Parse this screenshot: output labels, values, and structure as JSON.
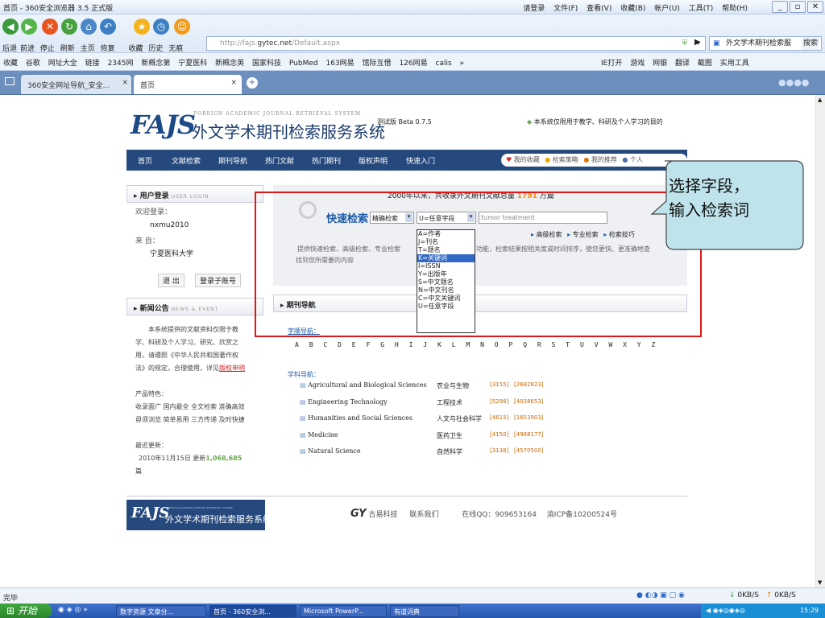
{
  "browser": {
    "window_title": "首页 - 360安全浏览器 3.5 正式版",
    "menu": [
      "请登录",
      "文件(F)",
      "查看(V)",
      "收藏(B)",
      "帐户(U)",
      "工具(T)",
      "帮助(H)"
    ],
    "nav_labels": [
      "后退",
      "前进",
      "停止",
      "刷新",
      "主页",
      "恢复",
      "收藏",
      "历史",
      "无痕"
    ],
    "url_prefix": "http://fajs.",
    "url_domain": "gytec.net",
    "url_path": "/Default.aspx",
    "search_box": "外文学术期刊检索服",
    "search_btn": "搜索",
    "favorites": [
      "收藏",
      "谷歌",
      "网址大全",
      "链接",
      "2345网",
      "新概念第",
      "宁夏医科",
      "新概念英",
      "国家科技",
      "PubMed",
      "163网易",
      "馆际互借",
      "126网易",
      "calis",
      "»"
    ],
    "favorites_right": [
      "IE打开",
      "游戏",
      "网银",
      "翻译",
      "截图",
      "实用工具"
    ],
    "tabs": [
      {
        "label": "360安全网址导航_安全..."
      },
      {
        "label": "首页"
      }
    ],
    "status_text": "完毕",
    "speed_down": "0KB/S",
    "speed_up": "0KB/S"
  },
  "page": {
    "logo_big": "FAJS",
    "logo_sub": "FOREIGN ACADEMIC JOURNAL RETRIEVAL SYSTEM",
    "logo_cn": "外文学术期刊检索服务系统",
    "version": "测试版 Beta 0.7.5",
    "notice": "本系统仅限用于教学、科研及个人学习的目的",
    "main_nav": [
      "首页",
      "文献检索",
      "期刊导航",
      "热门文献",
      "热门期刊",
      "版权声明",
      "快速入门"
    ],
    "user_links": [
      "我的收藏",
      "检索策略",
      "我的推荐",
      "个人"
    ],
    "login": {
      "header": "用户登录",
      "header_en": "USER LOGIN",
      "welcome": "欢迎登录：",
      "username": "nxmu2010",
      "from_label": "来  自：",
      "org": "宁夏医科大学",
      "logout": "退 出",
      "sub_login": "登录子账号"
    },
    "news": {
      "header": "新闻公告",
      "header_en": "NEWS & EVENT",
      "body_lines": [
        "本系统提供的文献资料仅限于教",
        "学、科研及个人学习、研究、欣赏之",
        "用，请遵照《中华人民共和国著作权",
        "法》的规定，合理使用，详见"
      ],
      "link": "版权申明",
      "feature_title": "产品特色：",
      "feature_lines": [
        "收录面广 国内最全 全文检索 准确高效",
        "毋须浏览 简单易用 三方传递 及时快捷"
      ],
      "update_title": "最近更新：",
      "update_text": "2010年11月15日 更新",
      "update_count": "1,068,685",
      "update_unit": "篇"
    },
    "quick_search": {
      "stats_prefix": "2000年以来，共收录外文期刊文献总量",
      "stats_count": "1791",
      "stats_unit": "万篇",
      "label": "快速检索",
      "mode": "精确检索",
      "field": "U=任意字段",
      "query": "tumor treatment",
      "links": [
        "高级检索",
        "专业检索",
        "检索技巧"
      ],
      "desc_1": "提供快速检索、高级检索、专业检索",
      "desc_2": "功能，检索结果按相关度或时间排序，使您更快、更准确地查",
      "desc_3": "找到您所需要的内容",
      "dropdown": [
        "A=作者",
        "J=刊名",
        "T=题名",
        "K=关键词",
        "I=ISSN",
        "Y=出版年",
        "S=中文题名",
        "N=中文刊名",
        "C=中文关键词",
        "U=任意字段"
      ],
      "dropdown_selected_index": 3
    },
    "journal_nav": {
      "header": "期刊导航",
      "alpha_title": "字顺导航：",
      "letters": [
        "A",
        "B",
        "C",
        "D",
        "E",
        "F",
        "G",
        "H",
        "I",
        "J",
        "K",
        "L",
        "M",
        "N",
        "O",
        "P",
        "Q",
        "R",
        "S",
        "T",
        "U",
        "V",
        "W",
        "X",
        "Y",
        "Z"
      ],
      "subject_title": "学科导航：",
      "subjects": [
        {
          "en": "Agricultural and Biological Sciences",
          "cn": "农业与生物",
          "n1": "[3155]",
          "n2": "[2682823]"
        },
        {
          "en": "Engineering Technology",
          "cn": "工程技术",
          "n1": "[5298]",
          "n2": "[4038653]"
        },
        {
          "en": "Humanities and Social Sciences",
          "cn": "人文与社会科学",
          "n1": "[4615]",
          "n2": "[1653903]"
        },
        {
          "en": "Medicine",
          "cn": "医药卫生",
          "n1": "[4150]",
          "n2": "[4988177]"
        },
        {
          "en": "Natural Science",
          "cn": "自然科学",
          "n1": "[3138]",
          "n2": "[4570500]"
        }
      ]
    },
    "footer": {
      "logo_big": "FAJS",
      "logo_sub": "FOREIGN ACADEMIC JOURNAL RETRIEVAL SYSTEM",
      "logo_cn": "外文学术期刊检索服务系统",
      "gy": "GY",
      "company": "古易科技",
      "contact": "联系我们",
      "qq": "在线QQ：909653164",
      "icp": "渝ICP备10200524号"
    }
  },
  "callout": {
    "line1": "选择字段，",
    "line2": "输入检索词"
  },
  "taskbar": {
    "start": "开始",
    "items": [
      "数字资源 文章分...",
      "首页 - 360安全浏...",
      "Microsoft PowerP...",
      "有道词典"
    ],
    "clock": "15:29"
  },
  "colors": {
    "brand": "#26497d",
    "accent_red": "#e01818",
    "callout_fill": "#bfe3ea",
    "link_red": "#cc2222",
    "stat_orange": "#ff8800"
  }
}
